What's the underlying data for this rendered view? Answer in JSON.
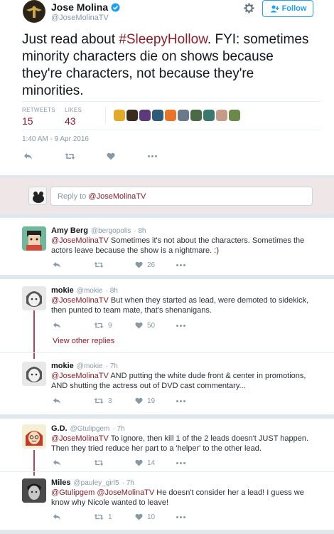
{
  "main_tweet": {
    "name": "Jose Molina",
    "handle": "@JoseMolinaTV",
    "follow_label": "Follow",
    "text_prefix": "Just read about ",
    "hashtag": "#SleepyHollow",
    "text_suffix": ". FYI: sometimes minority characters die on shows because they're characters, not because they're minorities.",
    "retweets_label": "RETWEETS",
    "retweets_count": "15",
    "likes_label": "LIKES",
    "likes_count": "43",
    "timestamp": "1:40 AM - 9 Apr 2016"
  },
  "reply_box": {
    "placeholder_prefix": "Reply to ",
    "placeholder_mention": "@JoseMolinaTV"
  },
  "replies": [
    {
      "name": "Amy Berg",
      "handle": "@bergopolis",
      "time": "· 8h",
      "mention": "@JoseMolinaTV",
      "text": " Sometimes it's not about the characters. Sometimes the actors leave because the show is a nightmare. :)",
      "retweets": "",
      "likes": "26"
    },
    {
      "name": "mokie",
      "handle": "@mokie",
      "time": "· 8h",
      "mention": "@JoseMolinaTV",
      "text": " But when they started as lead, were demoted to sidekick, then punted to team mate, that's shenanigans.",
      "retweets": "9",
      "likes": "50"
    },
    {
      "name": "mokie",
      "handle": "@mokie",
      "time": "· 7h",
      "mention": "@JoseMolinaTV",
      "text": " AND putting the white dude front & center in promotions, AND shutting the actress out of DVD cast commentary...",
      "retweets": "3",
      "likes": "19"
    },
    {
      "name": "G.D.",
      "handle": "@Gtulipgem",
      "time": "· 7h",
      "mention": "@JoseMolinaTV",
      "text": " To ignore, then kill 1 of the 2 leads doesn't JUST happen. Then they tried reduce her part to a 'helper' to the other lead.",
      "retweets": "",
      "likes": "14"
    },
    {
      "name": "Miles",
      "handle": "@pauley_girl5",
      "time": "· 7h",
      "mention1": "@Gtulipgem",
      "mention2": "@JoseMolinaTV",
      "text": " He doesn't consider her a lead! I guess we know why Nicole wanted to leave!",
      "retweets": "1",
      "likes": "10"
    }
  ],
  "view_other_replies": "View other replies",
  "colors": {
    "accent": "#8b1e2b",
    "follow_blue": "#1da1f2",
    "thread_line": "#b44552"
  }
}
